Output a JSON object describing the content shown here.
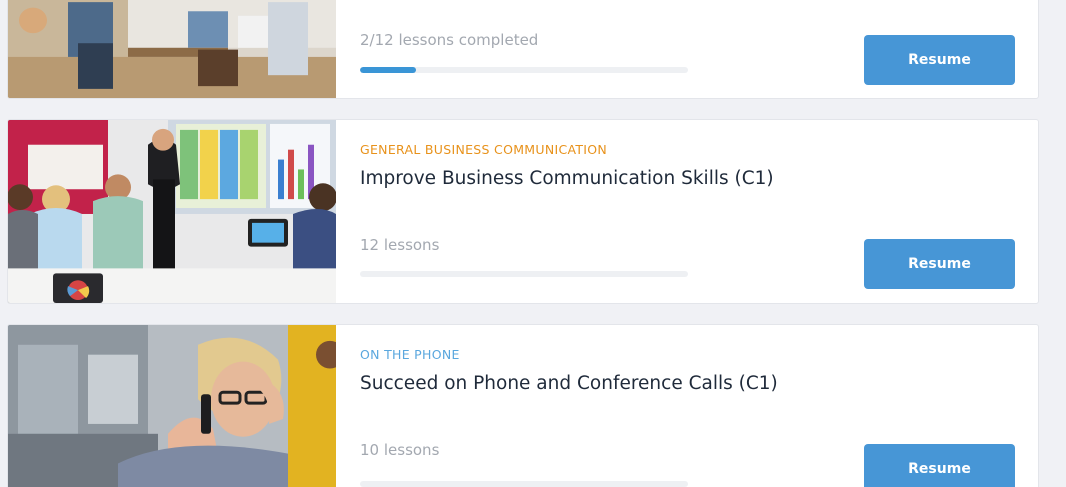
{
  "colors": {
    "accent": "#4796d6",
    "progress": "#3a95d6",
    "category_orange": "#e8921b",
    "category_blue": "#5aa7de",
    "page_bg": "#f0f1f5"
  },
  "courses": [
    {
      "category": "",
      "title": "",
      "lessons_text": "2/12 lessons completed",
      "progress": 0.17,
      "button_label": "Resume",
      "image": "office-team-photo"
    },
    {
      "category": "GENERAL BUSINESS COMMUNICATION",
      "title": "Improve Business Communication Skills (C1)",
      "lessons_text": "12 lessons",
      "progress": 0,
      "button_label": "Resume",
      "image": "presentation-meeting-photo"
    },
    {
      "category": "ON THE PHONE",
      "title": "Succeed on Phone and Conference Calls (C1)",
      "lessons_text": "10 lessons",
      "progress": 0,
      "button_label": "Resume",
      "image": "woman-on-phone-photo"
    }
  ]
}
